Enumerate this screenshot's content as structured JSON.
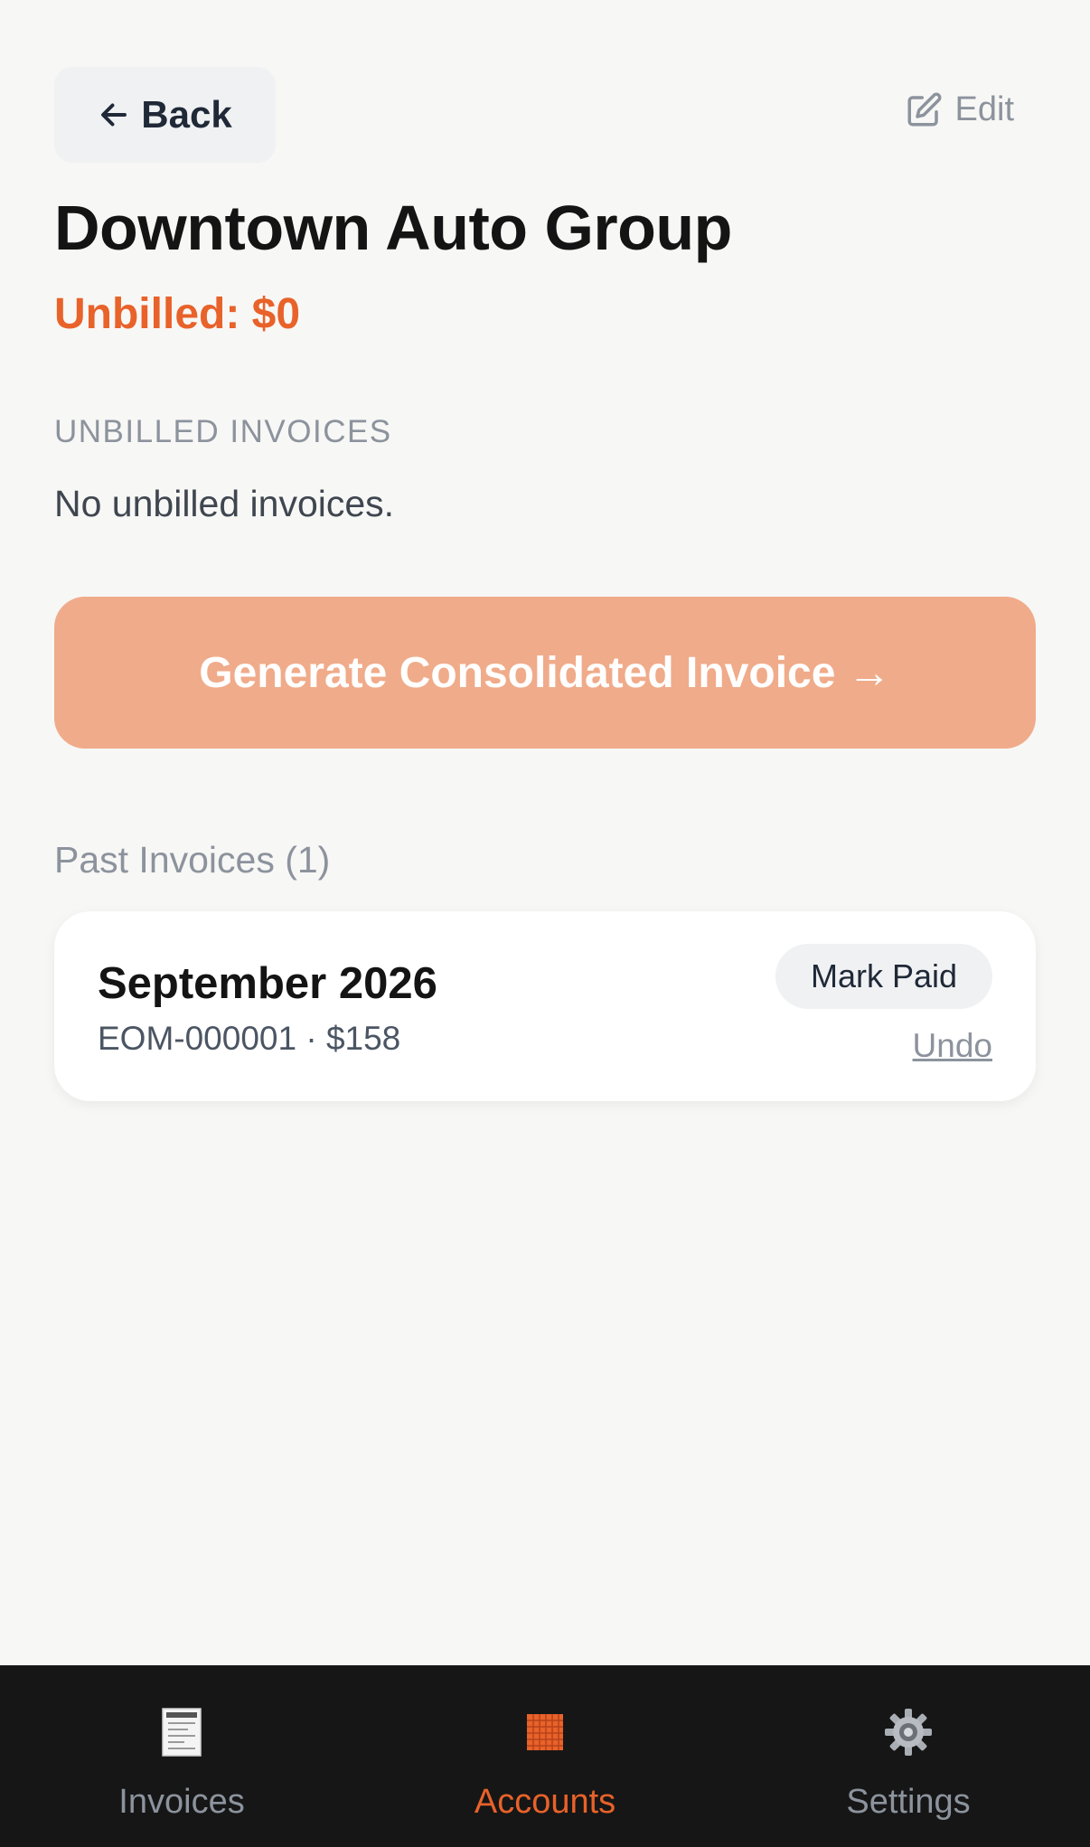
{
  "header": {
    "back_label": "Back",
    "edit_label": "Edit"
  },
  "account": {
    "name": "Downtown Auto Group",
    "unbilled_total": "Unbilled: $0"
  },
  "unbilled_section": {
    "label": "UNBILLED INVOICES",
    "empty_message": "No unbilled invoices."
  },
  "generate_button": {
    "label": "Generate Consolidated Invoice →"
  },
  "past_invoices": {
    "label": "Past Invoices (1)",
    "items": [
      {
        "title": "September 2026",
        "meta": "EOM-000001 · $158",
        "mark_paid_label": "Mark Paid",
        "undo_label": "Undo"
      }
    ]
  },
  "tab_bar": {
    "tabs": [
      {
        "label": "Invoices",
        "icon": "receipt-icon",
        "active": false
      },
      {
        "label": "Accounts",
        "icon": "building-icon",
        "active": true
      },
      {
        "label": "Settings",
        "icon": "gear-icon",
        "active": false
      }
    ]
  },
  "colors": {
    "accent": "#e8622a",
    "button_disabled": "#f0ab8a",
    "tab_bar_bg": "#161616",
    "background": "#f7f7f5"
  }
}
